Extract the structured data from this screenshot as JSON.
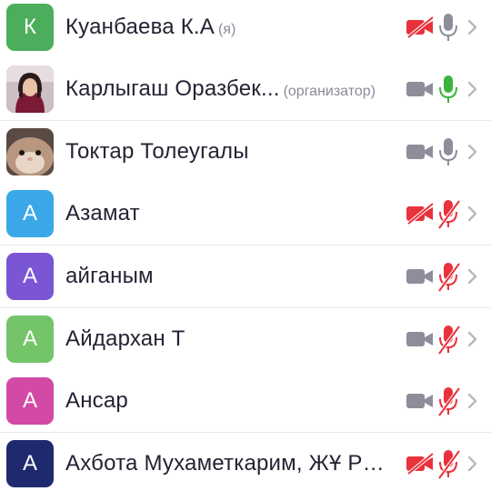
{
  "colors": {
    "muted_red": "#e8323c",
    "icon_gray": "#8e8e9a",
    "mic_active_green": "#3cb33c",
    "chevron_gray": "#b8b8c2"
  },
  "participants": [
    {
      "name": "Куанбаева К.А",
      "role": "(я)",
      "avatar_letter": "К",
      "avatar_color": "#4cae5c",
      "avatar_kind": "letter",
      "video": "off",
      "mic": "on"
    },
    {
      "name": "Карлыгаш Оразбек...",
      "role": "(организатор)",
      "avatar_letter": "",
      "avatar_color": "#6a3a4a",
      "avatar_kind": "photo-woman",
      "video": "on",
      "mic": "active"
    },
    {
      "name": "Токтар Толеугалы",
      "role": "",
      "avatar_letter": "",
      "avatar_color": "#8a6a58",
      "avatar_kind": "photo-hamster",
      "video": "on",
      "mic": "on"
    },
    {
      "name": "Азамат",
      "role": "",
      "avatar_letter": "А",
      "avatar_color": "#3aa8e8",
      "avatar_kind": "letter",
      "video": "off",
      "mic": "off"
    },
    {
      "name": "айганым",
      "role": "",
      "avatar_letter": "А",
      "avatar_color": "#7a56d4",
      "avatar_kind": "letter",
      "video": "on",
      "mic": "off"
    },
    {
      "name": "Айдархан Т",
      "role": "",
      "avatar_letter": "А",
      "avatar_color": "#74c46a",
      "avatar_kind": "letter",
      "video": "on",
      "mic": "off"
    },
    {
      "name": "Ансар",
      "role": "",
      "avatar_letter": "А",
      "avatar_color": "#d24aa6",
      "avatar_kind": "letter",
      "video": "on",
      "mic": "off"
    },
    {
      "name": "Ахбота Мухаметкарим, ЖҰ Ру...",
      "role": "",
      "avatar_letter": "А",
      "avatar_color": "#1f2a6e",
      "avatar_kind": "letter",
      "video": "off",
      "mic": "off"
    }
  ]
}
